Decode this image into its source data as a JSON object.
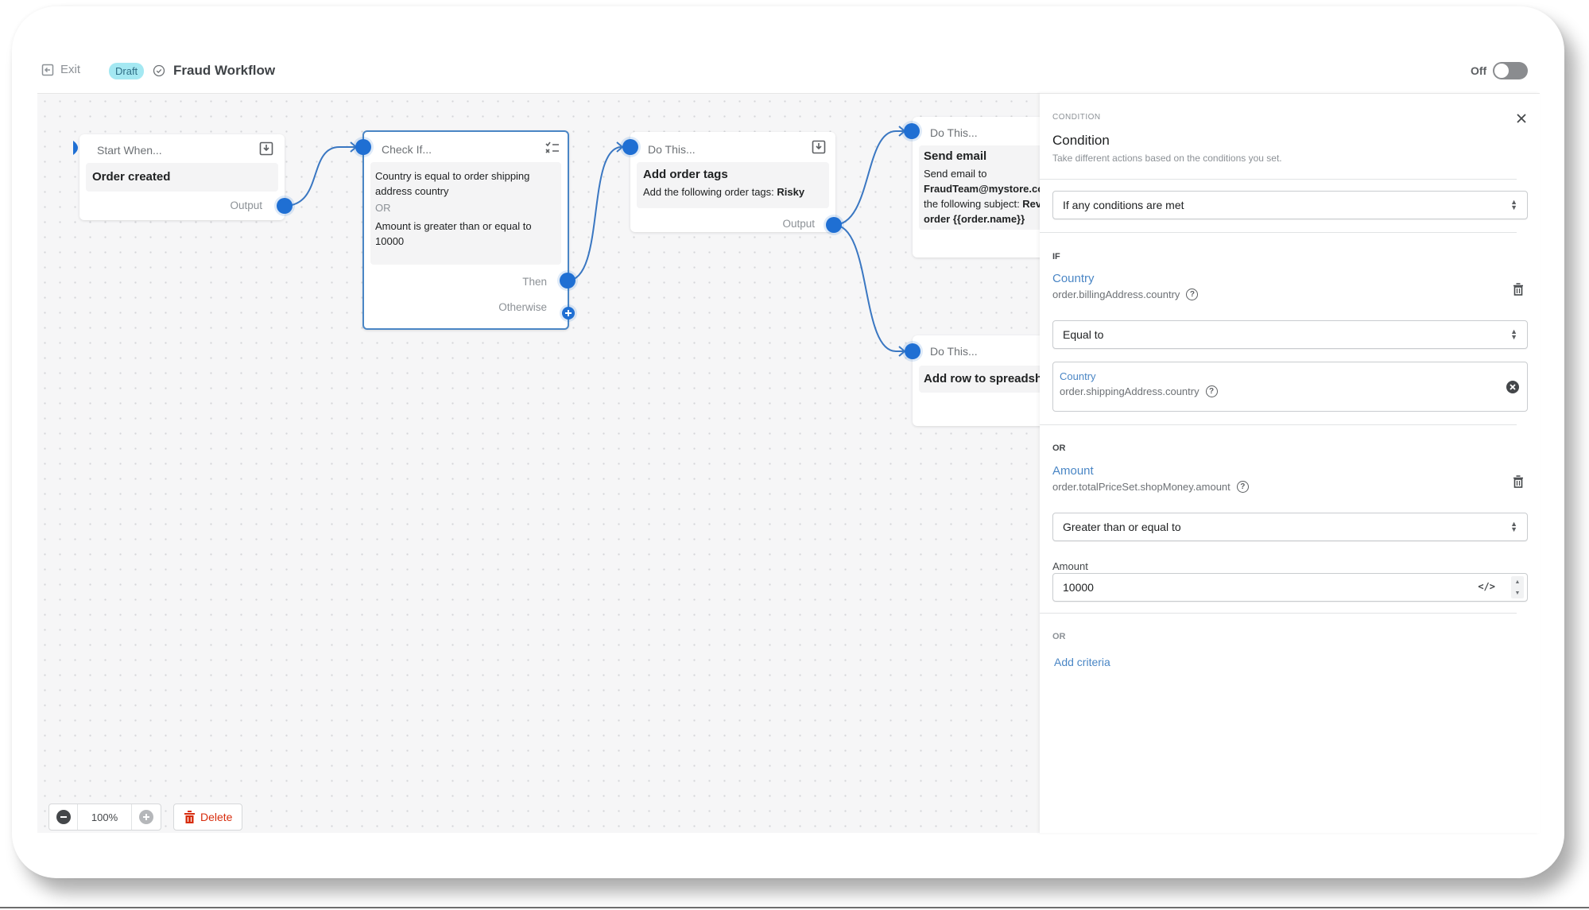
{
  "header": {
    "exit_label": "Exit",
    "status_badge": "Draft",
    "workflow_title": "Fraud Workflow",
    "toggle_label": "Off",
    "toggle_on": false
  },
  "canvas": {
    "nodes": [
      {
        "id": "start",
        "header": "Start When...",
        "title": "Order created",
        "ports": [
          "Output"
        ],
        "icon": "download-icon"
      },
      {
        "id": "check",
        "header": "Check If...",
        "conditions": [
          "Country is equal to order shipping address country",
          "Amount is greater than or equal to 10000"
        ],
        "separator": "OR",
        "ports": [
          "Then",
          "Otherwise"
        ],
        "icon": "checklist-icon"
      },
      {
        "id": "tags",
        "header": "Do This...",
        "title": "Add order tags",
        "description_prefix": "Add the following order tags: ",
        "description_bold": "Risky",
        "ports": [
          "Output"
        ],
        "icon": "download-icon"
      },
      {
        "id": "email",
        "header": "Do This...",
        "title": "Send email",
        "line1": "Send email to",
        "line2_bold": "FraudTeam@mystore.co",
        "line3_prefix": "the following subject: ",
        "line3_bold": "Rev",
        "line4_bold": "order {{order.name}}"
      },
      {
        "id": "sheet",
        "header": "Do This...",
        "title": "Add row to spreadshe"
      }
    ],
    "toolbar": {
      "zoom_level": "100%",
      "delete_label": "Delete"
    }
  },
  "panel": {
    "eyebrow": "CONDITION",
    "title": "Condition",
    "subtitle": "Take different actions based on the conditions you set.",
    "match_mode": "If any conditions are met",
    "if_label": "IF",
    "criteria": [
      {
        "field_name": "Country",
        "field_path": "order.billingAddress.country",
        "operator": "Equal to",
        "value_name": "Country",
        "value_path": "order.shippingAddress.country"
      },
      {
        "connector": "OR",
        "field_name": "Amount",
        "field_path": "order.totalPriceSet.shopMoney.amount",
        "operator": "Greater than or equal to",
        "value_label": "Amount",
        "value": "10000"
      }
    ],
    "or_label": "OR",
    "add_criteria": "Add criteria"
  },
  "colors": {
    "accent": "#1f6fd3",
    "link": "#4a86c5",
    "draft_bg": "#a4e8f2",
    "danger": "#d72c0d"
  }
}
